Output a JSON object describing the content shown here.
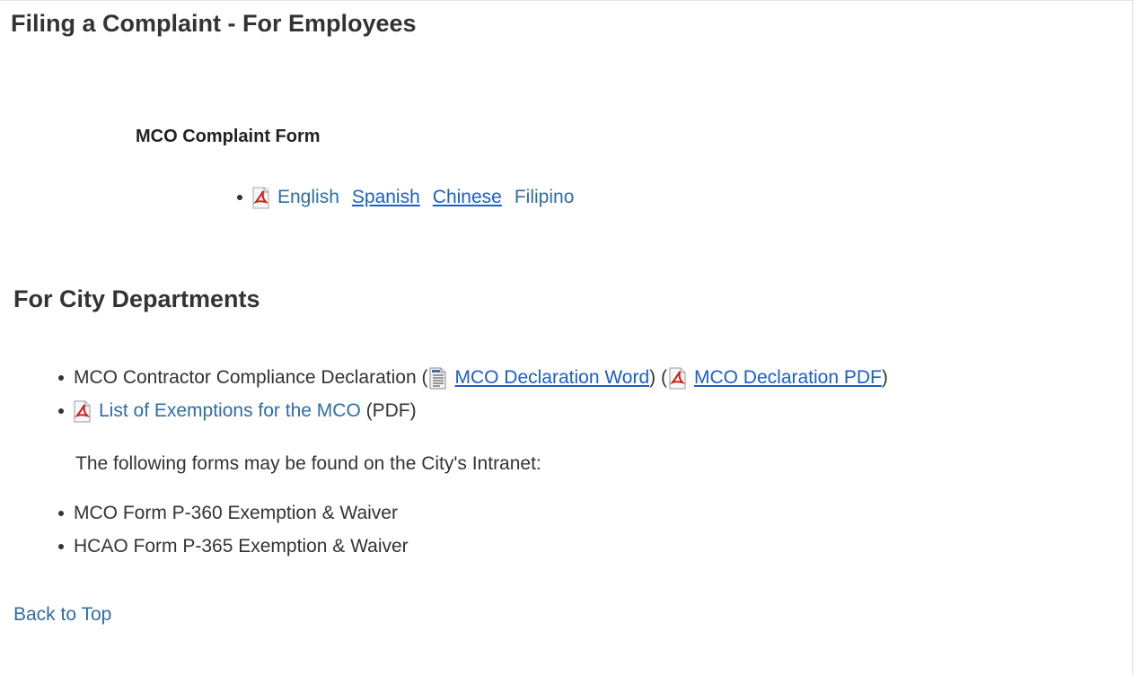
{
  "employees": {
    "heading": "Filing a Complaint - For Employees",
    "form_title": "MCO Complaint Form",
    "languages": [
      {
        "label": "English",
        "icon": "pdf-icon",
        "style": "plain"
      },
      {
        "label": "Spanish",
        "style": "underline"
      },
      {
        "label": "Chinese",
        "style": "underline"
      },
      {
        "label": "Filipino",
        "style": "plain"
      }
    ]
  },
  "departments": {
    "heading": "For City Departments",
    "items": [
      {
        "prefix": "MCO Contractor Compliance Declaration (",
        "word_link": "MCO Declaration Word",
        "middle": ") (",
        "pdf_link": "MCO Declaration PDF",
        "suffix": ")"
      },
      {
        "link": "List of Exemptions for the MCO",
        "suffix": " (PDF)"
      }
    ],
    "intranet_note": "The following forms may be found on the City's Intranet:",
    "intranet_items": [
      "MCO Form P-360 Exemption & Waiver",
      "HCAO Form P-365 Exemption & Waiver"
    ]
  },
  "back_to_top": "Back to Top",
  "colors": {
    "link_plain": "#2e6da4",
    "link_underline": "#1a5fc8",
    "text": "#333333",
    "pdf_red": "#d0201a"
  }
}
